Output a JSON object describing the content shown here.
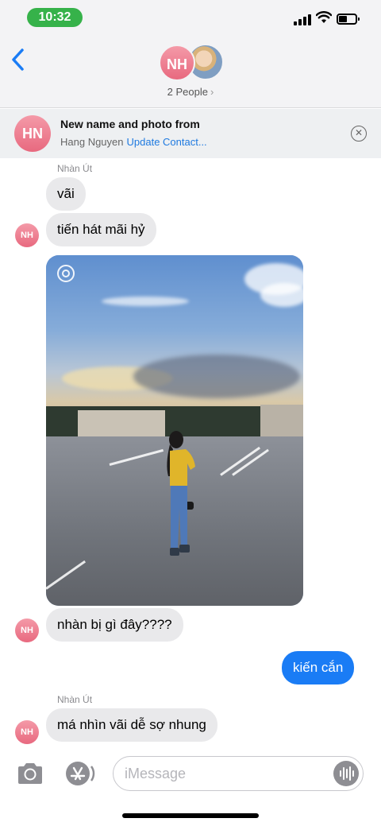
{
  "status_bar": {
    "time": "10:32",
    "time_pill_color": "#36b24a"
  },
  "header": {
    "group_initials": "NH",
    "people_label": "2 People",
    "people_chevron": "›",
    "back_icon": "chevron-left-icon"
  },
  "banner": {
    "initials": "HN",
    "title": "New name and photo from",
    "name": "Hang Nguyen",
    "link": "Update Contact...",
    "close_icon": "close-circle-icon",
    "close_glyph": "✕"
  },
  "messages": [
    {
      "sender": "Nhàn Út",
      "text": "vãi"
    },
    {
      "text": "tiến hát mãi hỷ",
      "avatar": "NH"
    },
    {
      "text": "nhàn bị gì đây????",
      "avatar": "NH"
    },
    {
      "text": "kiến cắn",
      "sent": true
    },
    {
      "sender": "Nhàn Út",
      "text": "má nhìn vãi dễ sợ nhung",
      "avatar": "NH"
    }
  ],
  "composer": {
    "placeholder": "iMessage",
    "camera_icon": "camera-icon",
    "apps_icon": "app-store-icon",
    "audio_icon": "audio-waveform-icon"
  },
  "colors": {
    "sent_bubble": "#1a7cf5",
    "received_bubble": "#e9e9eb",
    "link": "#1f7ae0",
    "avatar_pink": "#e8697f"
  }
}
